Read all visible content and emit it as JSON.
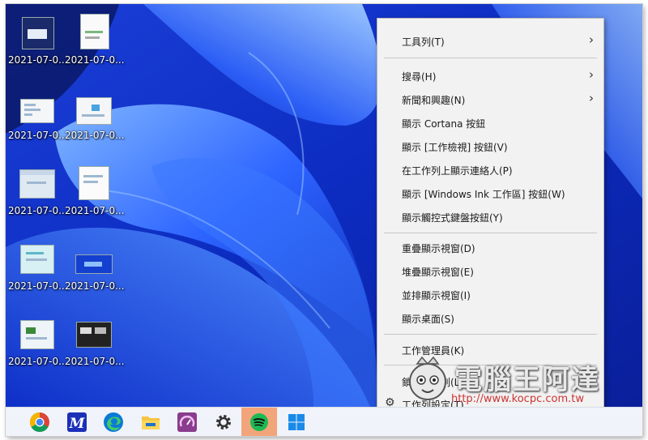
{
  "desktop": {
    "icons": [
      {
        "label": "2021-07-0..."
      },
      {
        "label": "2021-07-0..."
      },
      {
        "label": "2021-07-0..."
      },
      {
        "label": "2021-07-0..."
      },
      {
        "label": "2021-07-0..."
      },
      {
        "label": "2021-07-0..."
      },
      {
        "label": "2021-07-0..."
      },
      {
        "label": "2021-07-0..."
      },
      {
        "label": "2021-07-0..."
      },
      {
        "label": "2021-07-0..."
      }
    ]
  },
  "context_menu": {
    "items": [
      {
        "label": "工具列(T)",
        "submenu": true
      },
      {
        "label": "搜尋(H)",
        "submenu": true
      },
      {
        "label": "新聞和興趣(N)",
        "submenu": true
      },
      {
        "label": "顯示 Cortana 按鈕"
      },
      {
        "label": "顯示 [工作檢視] 按鈕(V)"
      },
      {
        "label": "在工作列上顯示連絡人(P)"
      },
      {
        "label": "顯示 [Windows Ink 工作區] 按鈕(W)"
      },
      {
        "label": "顯示觸控式鍵盤按鈕(Y)"
      },
      {
        "label": "重疊顯示視窗(D)"
      },
      {
        "label": "堆疊顯示視窗(E)"
      },
      {
        "label": "並排顯示視窗(I)"
      },
      {
        "label": "顯示桌面(S)"
      },
      {
        "label": "工作管理員(K)"
      },
      {
        "label": "鎖定工作列(L)"
      },
      {
        "label": "工作列設定(T)"
      }
    ],
    "arrow_glyph": "›"
  },
  "taskbar": {
    "apps": [
      "chrome-icon",
      "m-app-icon",
      "edge-icon",
      "file-explorer-icon",
      "speedometer-app-icon",
      "settings-gear-icon",
      "spotify-icon",
      "windows-start-icon"
    ],
    "active_color": "#f2a57a"
  },
  "watermark": {
    "title": "電腦王阿達",
    "url": "http://www.kocpc.com.tw"
  },
  "colors": {
    "wallpaper_dark": "#0a1a8a",
    "wallpaper_mid": "#1446e0",
    "wallpaper_light": "#6aa8ff",
    "menu_bg": "#f2f2f2"
  }
}
